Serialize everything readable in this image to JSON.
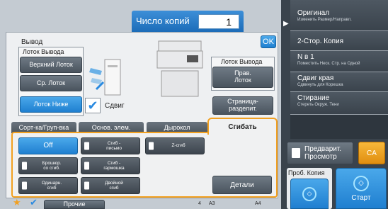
{
  "header": {
    "copies_label": "Число копий",
    "copies_value": "1",
    "ok": "OK"
  },
  "output": {
    "title": "Вывод",
    "tray_group_label": "Лоток Вывода",
    "trays": [
      "Верхний Лоток",
      "Ср. Лоток",
      "Лоток Ниже"
    ],
    "shift_label": "Сдвиг",
    "right_tray_group_label": "Лоток Вывода",
    "right_tray": "Прав.\nЛоток",
    "separator": "Страница-\nразделит."
  },
  "tabs": [
    "Сорт-ка/Груп-вка",
    "Основ. элем.",
    "Дырокол",
    "Сгибать"
  ],
  "fold": {
    "options": [
      {
        "label": "Off",
        "selected": true
      },
      {
        "label": "Сгиб -\nписьмо"
      },
      {
        "label": "Z-сгиб"
      },
      {
        "label": "Брошюр.\nсо сгиб."
      },
      {
        "label": "Сгиб -\nгармошка"
      },
      {
        "label": "Одинарн.\nсгиб"
      },
      {
        "label": "Двойной\nсгиб"
      }
    ],
    "details": "Детали"
  },
  "bottom": {
    "other": "Прочие",
    "a3": "A3",
    "a4": "A4",
    "n4": "4"
  },
  "right_panel": {
    "items": [
      {
        "main": "Оригинал",
        "sub": "Изменить Размер/Направл."
      },
      {
        "main": "2-Стор. Копия",
        "sub": ""
      },
      {
        "main": "N в 1",
        "sub": "Поместить Неск. Стр. на Одной"
      },
      {
        "main": "Сдвиг края",
        "sub": "Сдвинуть для Корешка"
      },
      {
        "main": "Стирание",
        "sub": "Стереть Окруж. Тени"
      }
    ],
    "preview": "Предварит.\nПросмотр",
    "ca": "CA",
    "proof": "Проб. Копия",
    "start": "Старт"
  },
  "colors": {
    "accent": "#2a8ae0",
    "orange": "#f2a020",
    "panel": "#eef0f2",
    "dark": "#3f4850"
  }
}
